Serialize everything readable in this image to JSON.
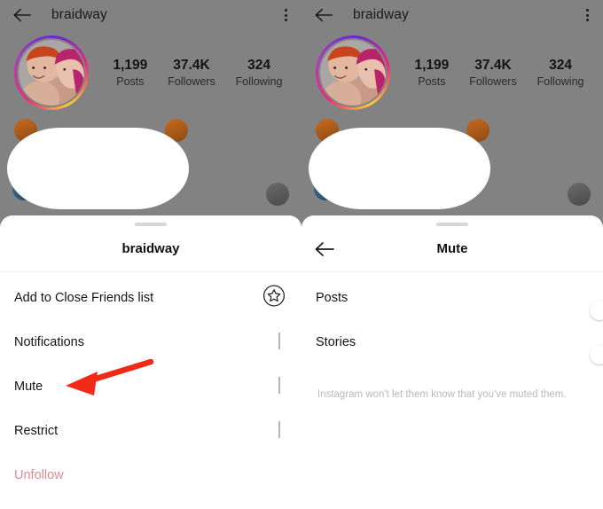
{
  "theme": {
    "background_gray": "#828282",
    "sheet_white": "#ffffff",
    "text_primary": "#141414",
    "chevron_gray": "#b6b6b6",
    "toggle_off": "#c4c4c4",
    "unfollow_red": "#e08b93",
    "annotation_red": "#ef2b17",
    "helper_text": "#b9b9b9"
  },
  "left_screen": {
    "appbar": {
      "back_icon": "back-arrow-icon",
      "title": "braidway",
      "menu_icon": "kebab-menu-icon"
    },
    "profile": {
      "avatar_alt": "profile-photo",
      "stats": [
        {
          "num": "1,199",
          "label": "Posts"
        },
        {
          "num": "37.4K",
          "label": "Followers"
        },
        {
          "num": "324",
          "label": "Following"
        }
      ]
    },
    "sheet": {
      "title": "braidway",
      "items": [
        {
          "label": "Add to Close Friends list",
          "trailing": "star-circle-icon"
        },
        {
          "label": "Notifications",
          "trailing": "chevron-right-icon"
        },
        {
          "label": "Mute",
          "trailing": "chevron-right-icon"
        },
        {
          "label": "Restrict",
          "trailing": "chevron-right-icon"
        },
        {
          "label": "Unfollow",
          "trailing": "none"
        }
      ]
    },
    "annotation": {
      "type": "arrow-left",
      "points_to": "Mute",
      "color": "#ef2b17"
    }
  },
  "right_screen": {
    "appbar": {
      "back_icon": "back-arrow-icon",
      "title": "braidway",
      "menu_icon": "kebab-menu-icon"
    },
    "profile": {
      "avatar_alt": "profile-photo",
      "stats": [
        {
          "num": "1,199",
          "label": "Posts"
        },
        {
          "num": "37.4K",
          "label": "Followers"
        },
        {
          "num": "324",
          "label": "Following"
        }
      ]
    },
    "sheet": {
      "back_icon": "back-arrow-icon",
      "title": "Mute",
      "toggles": [
        {
          "label": "Posts",
          "state": "off"
        },
        {
          "label": "Stories",
          "state": "off"
        }
      ],
      "helper_text": "Instagram won't let them know that you've muted them."
    }
  }
}
